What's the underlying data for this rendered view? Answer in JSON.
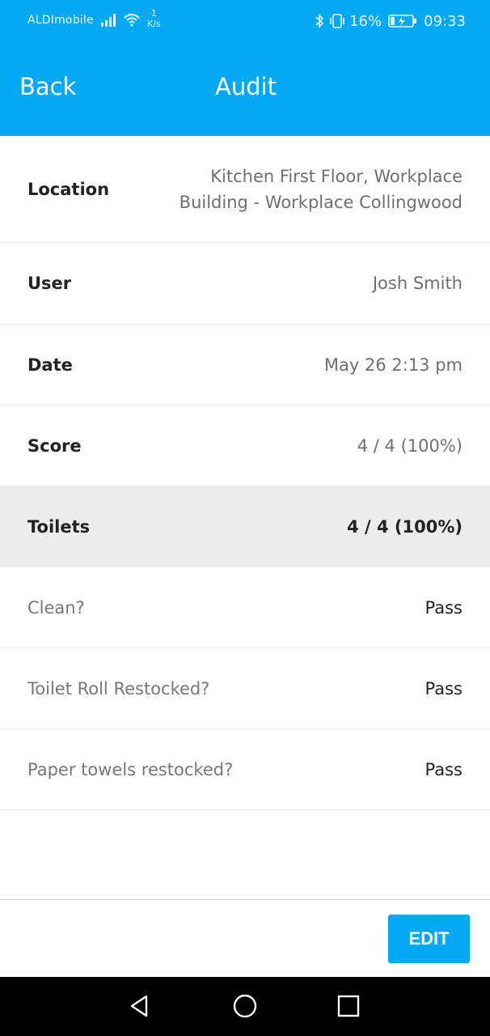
{
  "status_bar": {
    "carrier": "ALDImobile",
    "net_speed_value": "1",
    "net_speed_unit": "K/s",
    "battery_percent": "16%",
    "time": "09:33",
    "icons": [
      "signal-icon",
      "wifi-icon",
      "bluetooth-icon",
      "vibrate-icon",
      "battery-charging-icon"
    ]
  },
  "header": {
    "back_label": "Back",
    "title": "Audit"
  },
  "details": {
    "location_label": "Location",
    "location_value": "Kitchen First Floor, Workplace Building - Workplace Collingwood",
    "user_label": "User",
    "user_value": "Josh Smith",
    "date_label": "Date",
    "date_value": "May 26 2:13 pm",
    "score_label": "Score",
    "score_value": "4 / 4 (100%)"
  },
  "section": {
    "name": "Toilets",
    "score": "4 / 4 (100%)",
    "items": [
      {
        "question": "Clean?",
        "result": "Pass"
      },
      {
        "question": "Toilet Roll Restocked?",
        "result": "Pass"
      },
      {
        "question": "Paper towels restocked?",
        "result": "Pass"
      }
    ]
  },
  "footer": {
    "edit_label": "EDIT"
  },
  "nav_bar": {
    "icons": [
      "nav-back-icon",
      "nav-home-icon",
      "nav-recents-icon"
    ]
  },
  "colors": {
    "accent": "#03a9f4",
    "section_bg": "#ececec",
    "text_dark": "#222222",
    "text_muted": "#6f6f6f"
  }
}
